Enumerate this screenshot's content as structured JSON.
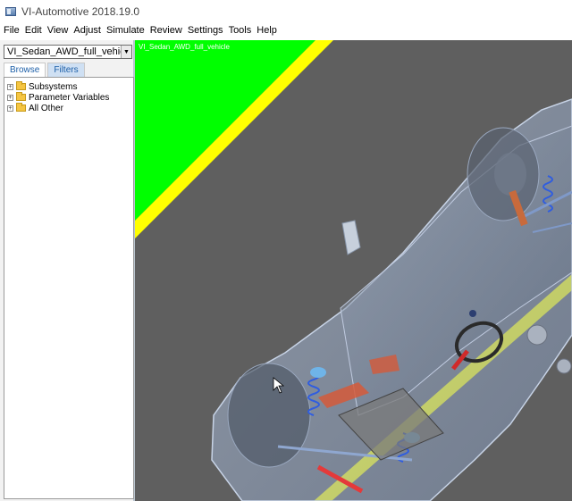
{
  "app": {
    "title": "VI-Automotive 2018.19.0"
  },
  "menu": [
    "File",
    "Edit",
    "View",
    "Adjust",
    "Simulate",
    "Review",
    "Settings",
    "Tools",
    "Help"
  ],
  "sidebar": {
    "model_select_value": "VI_Sedan_AWD_full_vehicle",
    "tabs": [
      {
        "label": "Browse",
        "active": true
      },
      {
        "label": "Filters",
        "active": false
      }
    ],
    "tree_items": [
      {
        "label": "Subsystems",
        "expander": "+",
        "icon": "folder-icon"
      },
      {
        "label": "Parameter Variables",
        "expander": "+",
        "icon": "folder-icon"
      },
      {
        "label": "All Other",
        "expander": "+",
        "icon": "folder-icon"
      }
    ]
  },
  "viewport": {
    "model_label": "VI_Sedan_AWD_full_vehicle",
    "colors": {
      "background": "#5f5f5f",
      "ground": "#00ff00",
      "stripe": "#ffff00",
      "body": "#9fb4d4"
    }
  }
}
